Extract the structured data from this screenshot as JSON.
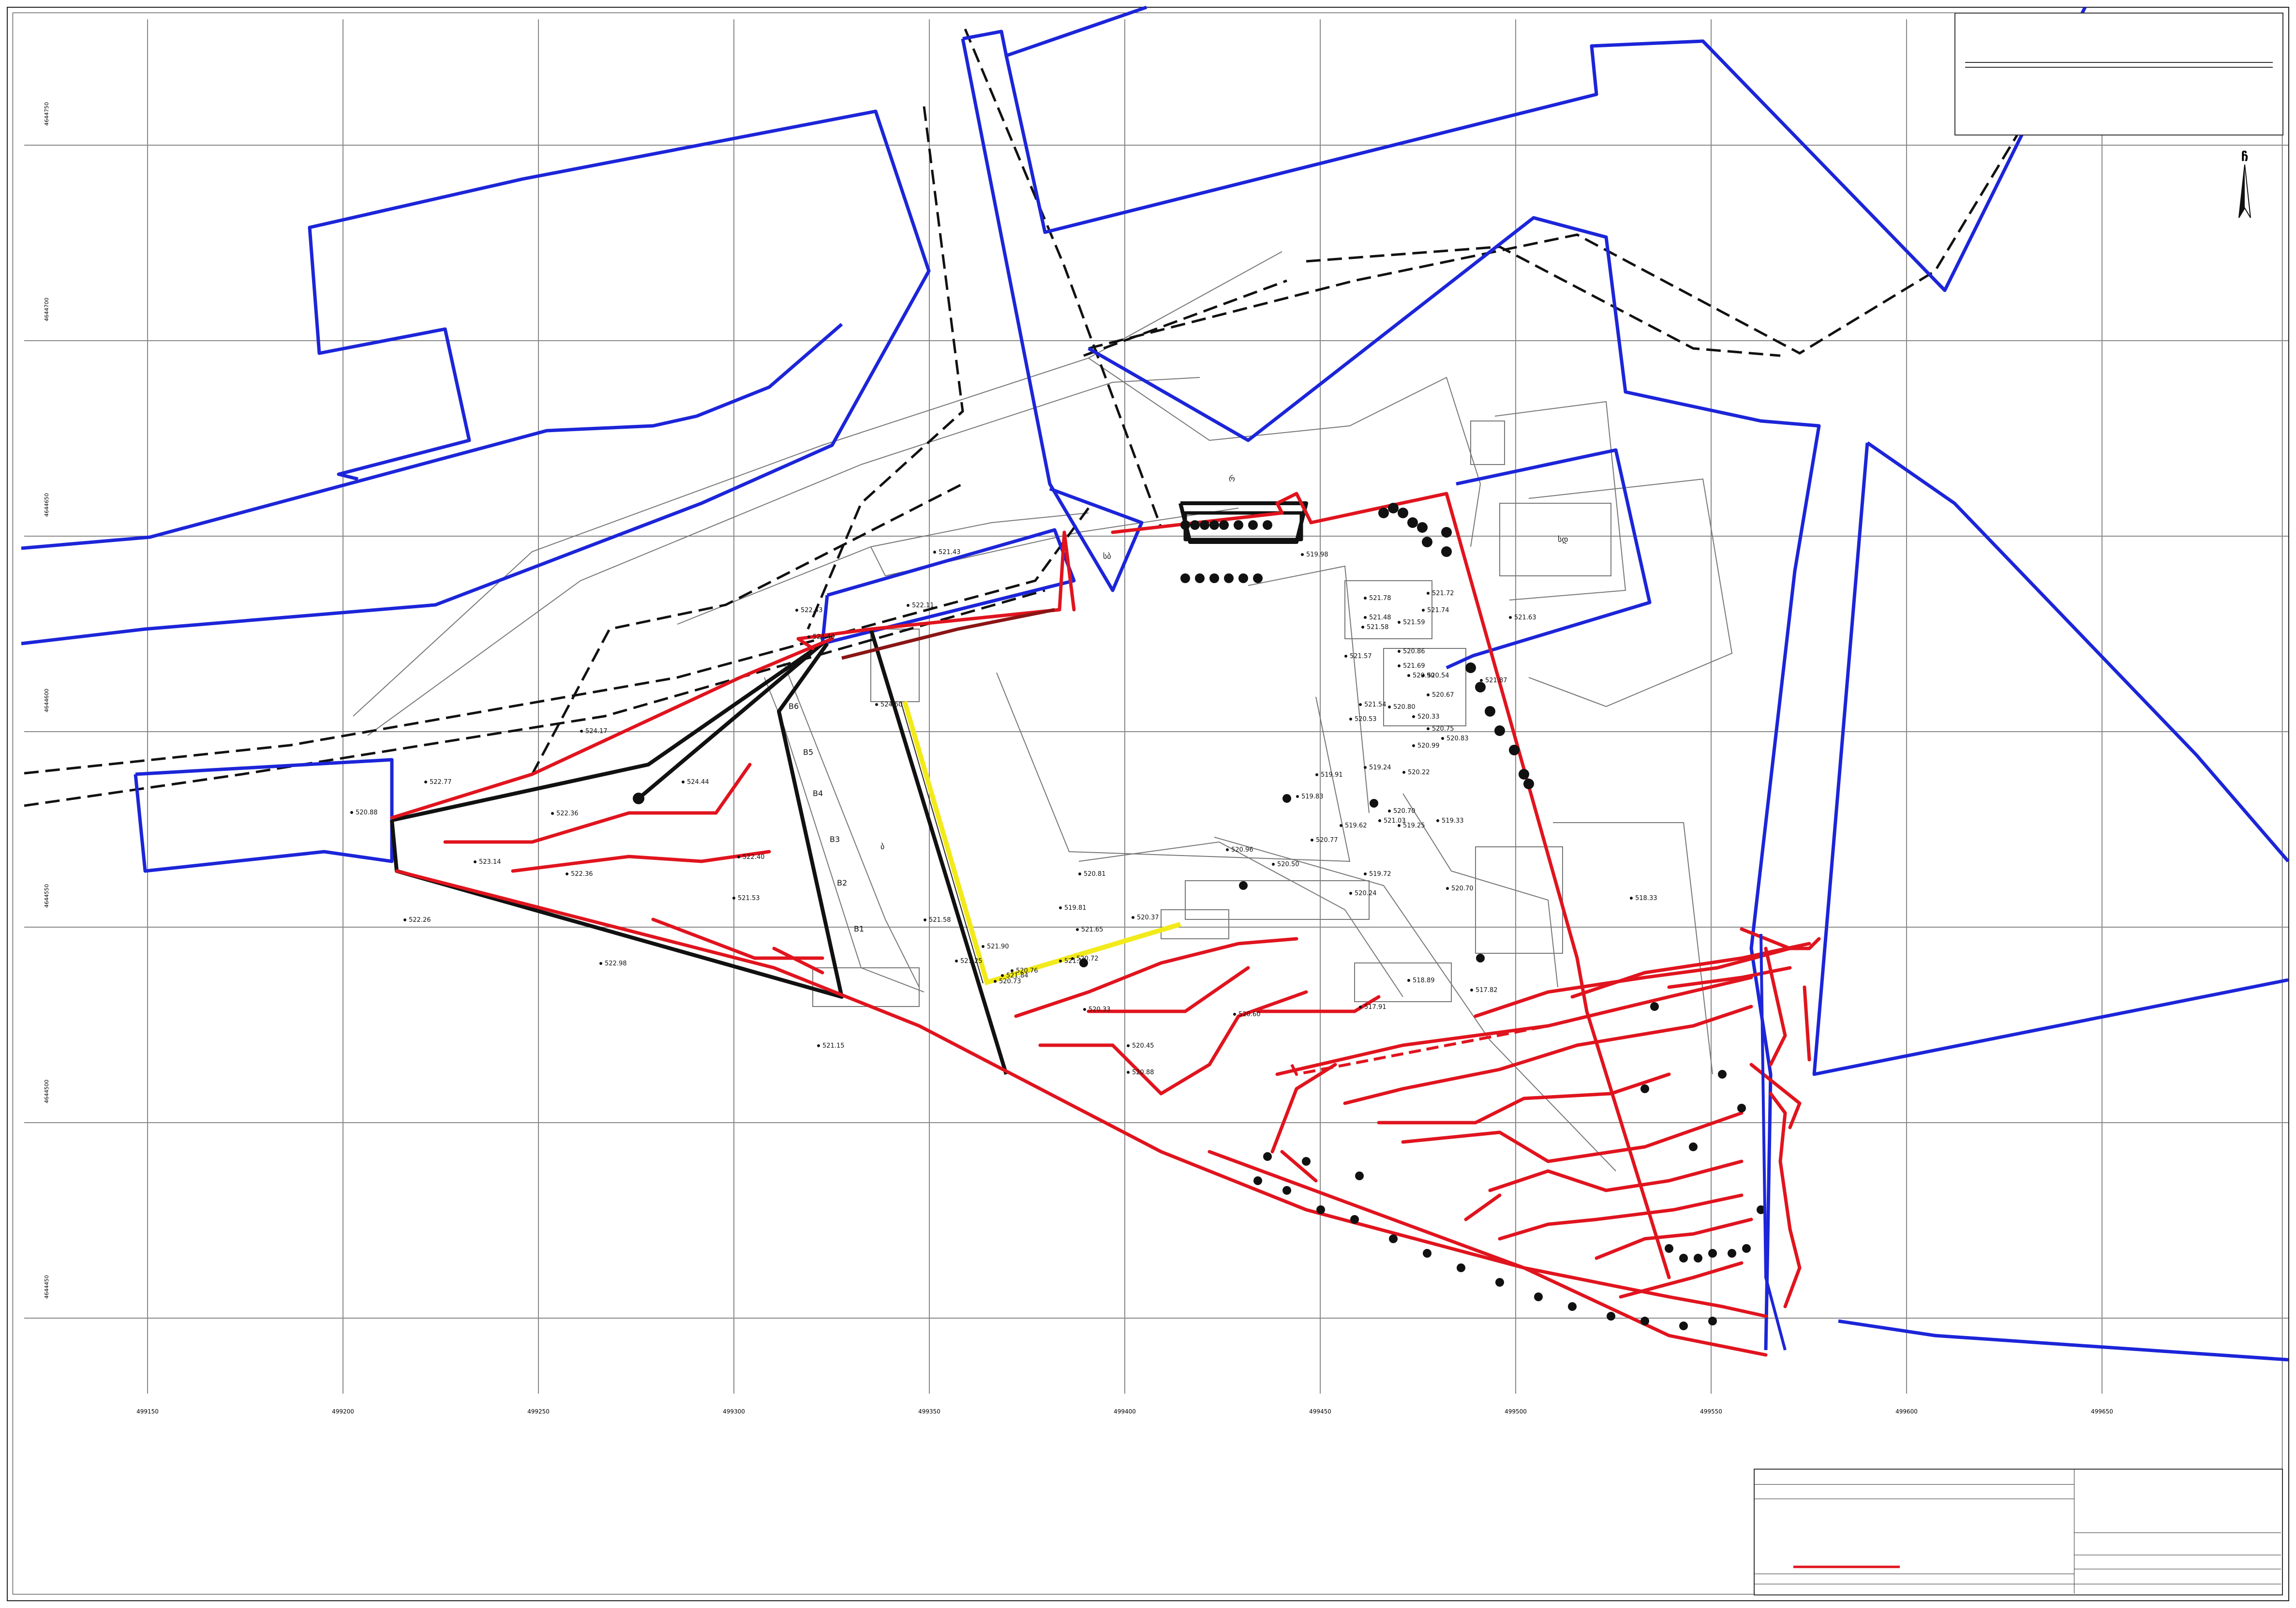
{
  "title_block": {
    "line1": "",
    "line2": "",
    "line3": "",
    "sheet_title": ""
  },
  "north_arrow": "ჩ",
  "x_axis_ticks": [
    "499150",
    "499200",
    "499250",
    "499300",
    "499350",
    "499400",
    "499450",
    "499500",
    "499550",
    "499600",
    "499650"
  ],
  "y_axis_ticks": [
    "4644750",
    "4644700",
    "4644650",
    "4644600",
    "4644550",
    "4644500",
    "4644450"
  ],
  "elevation_labels": [
    "524.17",
    "522.77",
    "520.88",
    "522.36",
    "523.14",
    "522.36",
    "522.26",
    "522.98",
    "521.15",
    "521.53",
    "522.40",
    "524.44",
    "524.40",
    "522.43",
    "522.11",
    "524.60",
    "521.58",
    "521.25",
    "521.90",
    "520.76",
    "519.81",
    "521.65",
    "521.84",
    "521.10",
    "520.72",
    "520.73",
    "520.37",
    "520.81",
    "520.96",
    "520.50",
    "520.77",
    "520.88",
    "520.60",
    "520.33",
    "520.45",
    "520.24",
    "519.72",
    "519.62",
    "519.24",
    "519.25",
    "521.03",
    "520.70",
    "520.99",
    "520.53",
    "520.80",
    "520.67",
    "520.75",
    "520.90",
    "521.69",
    "521.54",
    "521.57",
    "521.58",
    "521.78",
    "521.72",
    "521.74",
    "521.59",
    "521.48",
    "520.86",
    "520.54",
    "520.33",
    "520.83",
    "520.22",
    "519.91",
    "519.83",
    "519.33",
    "518.33",
    "518.89",
    "517.91",
    "517.82",
    "520.70",
    "521.87",
    "519.98",
    "521.63",
    "521.43"
  ],
  "map_labels": {
    "building_a": "ბ",
    "label_sa": "სბ",
    "label_sd": "სდ",
    "label_r": "რ",
    "block_b1": "B1",
    "block_b2": "B2",
    "block_b3": "B3",
    "block_b4": "B4",
    "block_b5": "B5",
    "block_b6": "B6"
  },
  "legend": {
    "heading": "",
    "subheading_black": "",
    "subheading_red": "",
    "scale": "",
    "date": "",
    "rows_left": [
      "",
      "",
      "",
      "",
      "",
      ""
    ],
    "rows_right": [
      "",
      "",
      "",
      "",
      "",
      ""
    ],
    "note1": "",
    "note2": "",
    "side_labels": [
      "",
      "",
      ""
    ]
  },
  "colors": {
    "parcel_boundary": "#1c25d8",
    "red_lines": "#e0141e",
    "yellow_line": "#f2ea1b",
    "black_lines": "#111111",
    "grid": "#888888"
  }
}
